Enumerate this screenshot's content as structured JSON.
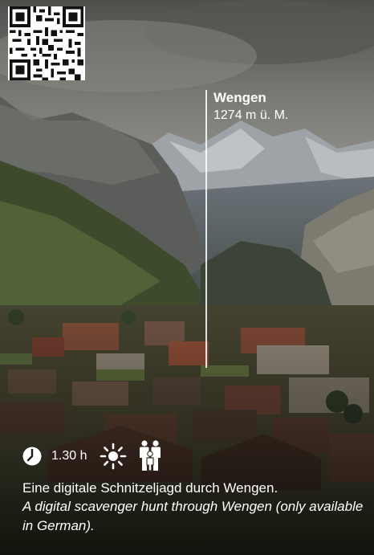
{
  "place": {
    "name": "Wengen",
    "altitude": "1274 m ü. M."
  },
  "info": {
    "duration": "1.30 h",
    "icons": [
      "clock-icon",
      "sun-icon",
      "family-icon"
    ]
  },
  "description": {
    "german": "Eine digitale Schnitzeljagd durch Wengen.",
    "english": "A digital scavenger hunt through Wengen (only available in German)."
  },
  "colors": {
    "text": "#ffffff",
    "sky": "#7e7f7a",
    "mountain": "#4a4d48",
    "roofs": "#6a3e2e"
  }
}
